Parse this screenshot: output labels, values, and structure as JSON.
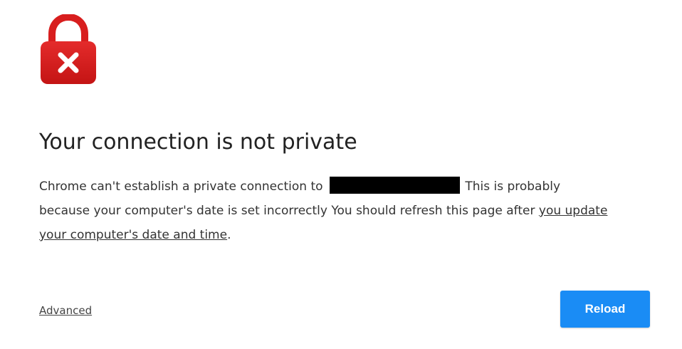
{
  "icon": {
    "name": "lock-error-icon",
    "color": "#d81e1e"
  },
  "heading": {
    "title": "Your connection is not private"
  },
  "message": {
    "part1": "Chrome can't establish a private connection to",
    "part2": "This is probably because your computer's date is set incorrectly You should refresh this page after",
    "link": "you update your computer's date and time",
    "end": "."
  },
  "actions": {
    "advanced_label": "Advanced",
    "reload_label": "Reload"
  },
  "colors": {
    "accent": "#1a8cf5",
    "redaction": "#000000"
  }
}
